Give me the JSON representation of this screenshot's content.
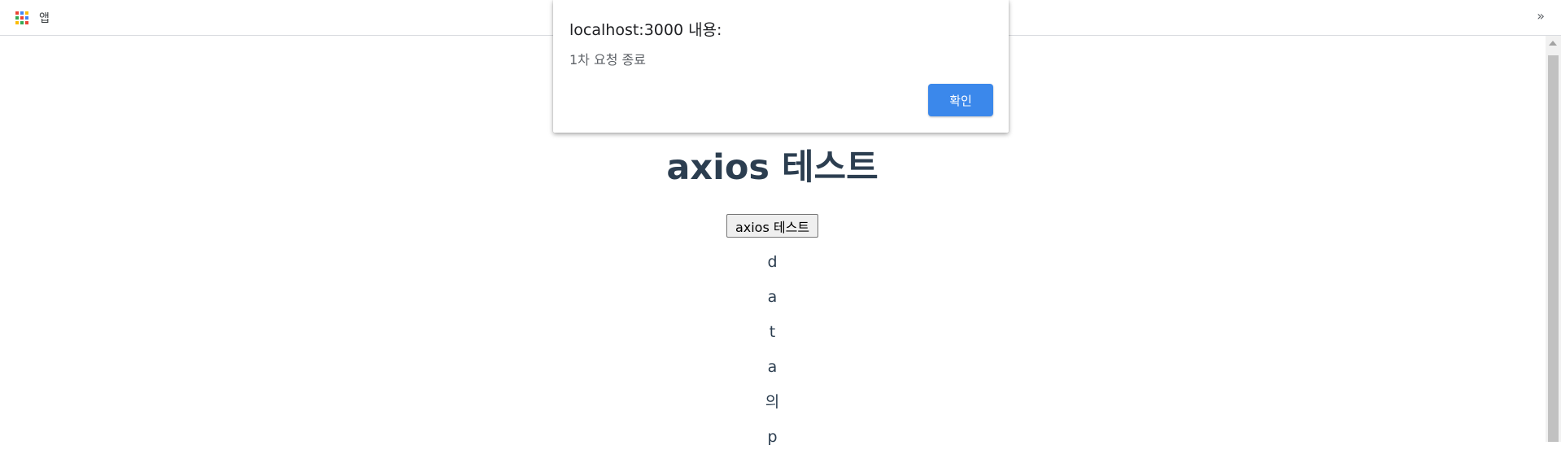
{
  "bookmarks_bar": {
    "apps_label": "앱",
    "apps_icon": "apps-grid-icon",
    "overflow_label": "»",
    "apps_grid_colors": [
      "#ea4335",
      "#4285f4",
      "#fbbc05",
      "#34a853",
      "#ea4335",
      "#4285f4",
      "#fbbc05",
      "#34a853",
      "#ea4335"
    ]
  },
  "page": {
    "title": "axios 테스트",
    "button_label": "axios 테스트",
    "chars": [
      "d",
      "a",
      "t",
      "a",
      "의",
      "p"
    ],
    "text_color": "#2c3e50"
  },
  "alert": {
    "title": "localhost:3000 내용:",
    "message": "1차 요청 종료",
    "ok_label": "확인",
    "ok_color": "#3b88eb"
  }
}
